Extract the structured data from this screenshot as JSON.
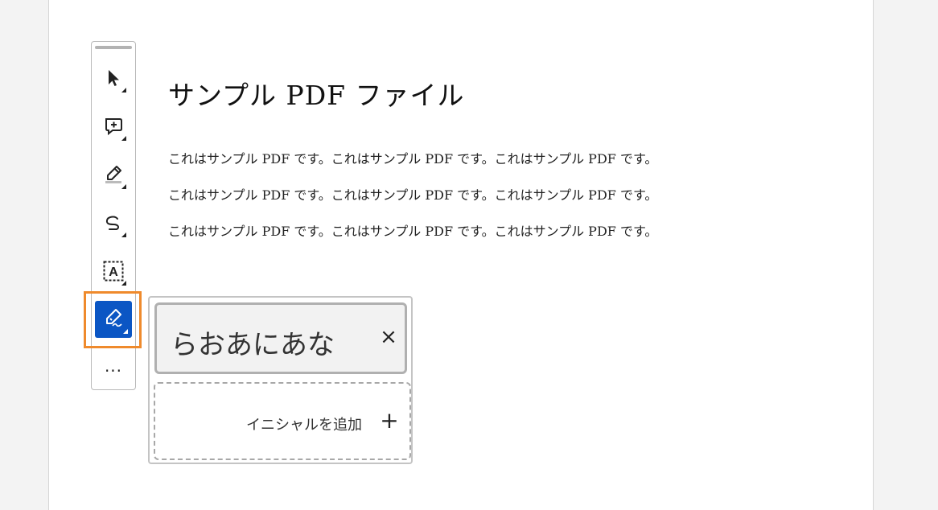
{
  "document": {
    "title": "サンプル PDF ファイル",
    "lines": [
      "これはサンプル PDF です。これはサンプル PDF です。これはサンプル PDF です。",
      "これはサンプル PDF です。これはサンプル PDF です。これはサンプル PDF です。",
      "これはサンプル PDF です。これはサンプル PDF です。これはサンプル PDF です。"
    ]
  },
  "toolbar": {
    "tools": [
      {
        "icon": "cursor-arrow-icon"
      },
      {
        "icon": "add-comment-icon"
      },
      {
        "icon": "highlight-pen-icon"
      },
      {
        "icon": "freehand-draw-icon"
      },
      {
        "icon": "text-box-icon",
        "glyph": "A"
      },
      {
        "icon": "sign-pen-icon",
        "active": true
      }
    ],
    "more_label": "...",
    "active_color": "#0b56c4",
    "highlight_color": "#ef8a2c"
  },
  "signature_popup": {
    "signature_text": "らおあにあな",
    "remove_label": "×",
    "add_initials_label": "イニシャルを追加",
    "add_icon": "+"
  }
}
